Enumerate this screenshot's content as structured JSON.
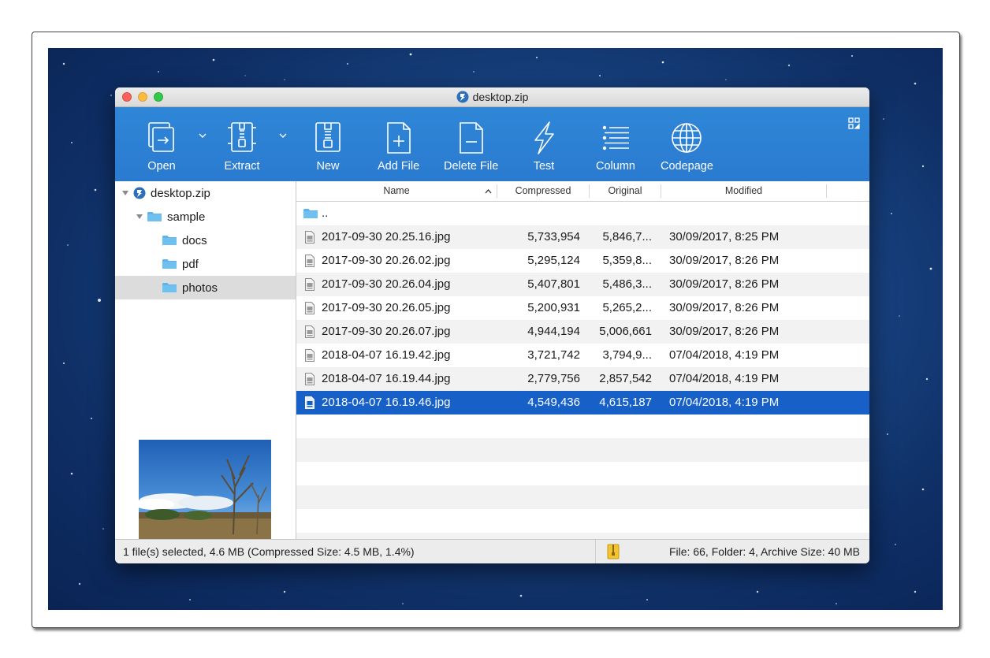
{
  "window": {
    "title": "desktop.zip"
  },
  "toolbar": {
    "open_label": "Open",
    "extract_label": "Extract",
    "new_label": "New",
    "add_file_label": "Add File",
    "delete_file_label": "Delete File",
    "test_label": "Test",
    "column_label": "Column",
    "codepage_label": "Codepage",
    "accent": "#2a7bd0"
  },
  "sidebar": {
    "items": [
      {
        "label": "desktop.zip"
      },
      {
        "label": "sample"
      },
      {
        "label": "docs"
      },
      {
        "label": "pdf"
      },
      {
        "label": "photos"
      }
    ]
  },
  "list": {
    "columns": {
      "name": "Name",
      "compressed": "Compressed",
      "original": "Original",
      "modified": "Modified"
    },
    "parent": "..",
    "rows": [
      {
        "name": "2017-09-30 20.25.16.jpg",
        "compressed": "5,733,954",
        "original": "5,846,7...",
        "modified": "30/09/2017, 8:25 PM"
      },
      {
        "name": "2017-09-30 20.26.02.jpg",
        "compressed": "5,295,124",
        "original": "5,359,8...",
        "modified": "30/09/2017, 8:26 PM"
      },
      {
        "name": "2017-09-30 20.26.04.jpg",
        "compressed": "5,407,801",
        "original": "5,486,3...",
        "modified": "30/09/2017, 8:26 PM"
      },
      {
        "name": "2017-09-30 20.26.05.jpg",
        "compressed": "5,200,931",
        "original": "5,265,2...",
        "modified": "30/09/2017, 8:26 PM"
      },
      {
        "name": "2017-09-30 20.26.07.jpg",
        "compressed": "4,944,194",
        "original": "5,006,661",
        "modified": "30/09/2017, 8:26 PM"
      },
      {
        "name": "2018-04-07 16.19.42.jpg",
        "compressed": "3,721,742",
        "original": "3,794,9...",
        "modified": "07/04/2018, 4:19 PM"
      },
      {
        "name": "2018-04-07 16.19.44.jpg",
        "compressed": "2,779,756",
        "original": "2,857,542",
        "modified": "07/04/2018, 4:19 PM"
      },
      {
        "name": "2018-04-07 16.19.46.jpg",
        "compressed": "4,549,436",
        "original": "4,615,187",
        "modified": "07/04/2018, 4:19 PM"
      }
    ],
    "selected_color": "#1660c8"
  },
  "status": {
    "left": "1 file(s) selected, 4.6 MB (Compressed Size: 4.5 MB, 1.4%)",
    "right": "File: 66, Folder: 4, Archive Size: 40 MB"
  }
}
